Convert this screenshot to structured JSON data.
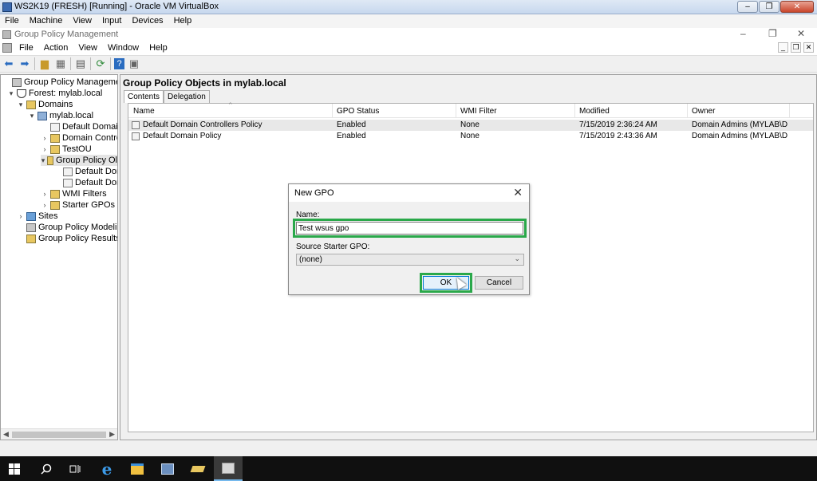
{
  "vbox": {
    "title": "WS2K19 (FRESH) [Running] - Oracle VM VirtualBox",
    "menu": [
      "File",
      "Machine",
      "View",
      "Input",
      "Devices",
      "Help"
    ]
  },
  "gpm": {
    "title": "Group Policy Management",
    "menu": [
      "File",
      "Action",
      "View",
      "Window",
      "Help"
    ]
  },
  "tree": {
    "items": [
      {
        "label": "Group Policy Management",
        "chev": ""
      },
      {
        "label": "Forest: mylab.local",
        "chev": "▾"
      },
      {
        "label": "Domains",
        "chev": "▾"
      },
      {
        "label": "mylab.local",
        "chev": "▾"
      },
      {
        "label": "Default Domain",
        "chev": ""
      },
      {
        "label": "Domain Contro",
        "chev": "›"
      },
      {
        "label": "TestOU",
        "chev": "›"
      },
      {
        "label": "Group Policy Ol",
        "chev": "▾"
      },
      {
        "label": "Default Dom",
        "chev": ""
      },
      {
        "label": "Default Dom",
        "chev": ""
      },
      {
        "label": "WMI Filters",
        "chev": "›"
      },
      {
        "label": "Starter GPOs",
        "chev": "›"
      },
      {
        "label": "Sites",
        "chev": "›"
      },
      {
        "label": "Group Policy Modeling",
        "chev": ""
      },
      {
        "label": "Group Policy Results",
        "chev": ""
      }
    ]
  },
  "pane": {
    "header": "Group Policy Objects in mylab.local",
    "tabs": [
      "Contents",
      "Delegation"
    ],
    "columns": [
      "Name",
      "GPO Status",
      "WMI Filter",
      "Modified",
      "Owner"
    ],
    "rows": [
      [
        "Default Domain Controllers Policy",
        "Enabled",
        "None",
        "7/15/2019 2:36:24 AM",
        "Domain Admins (MYLAB\\Dom..."
      ],
      [
        "Default Domain Policy",
        "Enabled",
        "None",
        "7/15/2019 2:43:36 AM",
        "Domain Admins (MYLAB\\Dom..."
      ]
    ]
  },
  "dialog": {
    "title": "New GPO",
    "name_label": "Name:",
    "name_value": "Test wsus gpo",
    "starter_label": "Source Starter GPO:",
    "starter_value": "(none)",
    "ok_label": "OK",
    "cancel_label": "Cancel",
    "highlight_color": "#2aa84a"
  }
}
